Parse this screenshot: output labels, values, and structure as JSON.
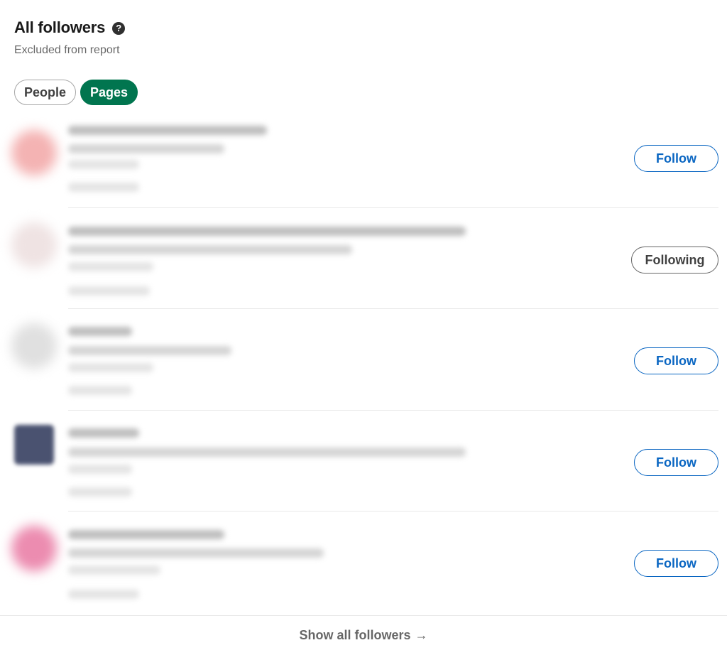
{
  "header": {
    "title": "All followers",
    "help_icon": "question-circle-icon",
    "subtitle": "Excluded from report"
  },
  "filters": [
    {
      "label": "People",
      "active": false
    },
    {
      "label": "Pages",
      "active": true
    }
  ],
  "colors": {
    "active_pill": "#01754f",
    "follow_blue": "#0a66c2",
    "divider": "#e8e8e8"
  },
  "rows": [
    {
      "action_label": "Follow",
      "state": "follow",
      "avatar_color": "#f4b3b3"
    },
    {
      "action_label": "Following",
      "state": "following",
      "avatar_color": "#e9d7d7"
    },
    {
      "action_label": "Follow",
      "state": "follow",
      "avatar_color": "#dcdcdc"
    },
    {
      "action_label": "Follow",
      "state": "follow",
      "avatar_color": "#4a5270"
    },
    {
      "action_label": "Follow",
      "state": "follow",
      "avatar_color": "#ec8cb0"
    }
  ],
  "footer": {
    "show_all_label": "Show all followers",
    "arrow": "→"
  }
}
